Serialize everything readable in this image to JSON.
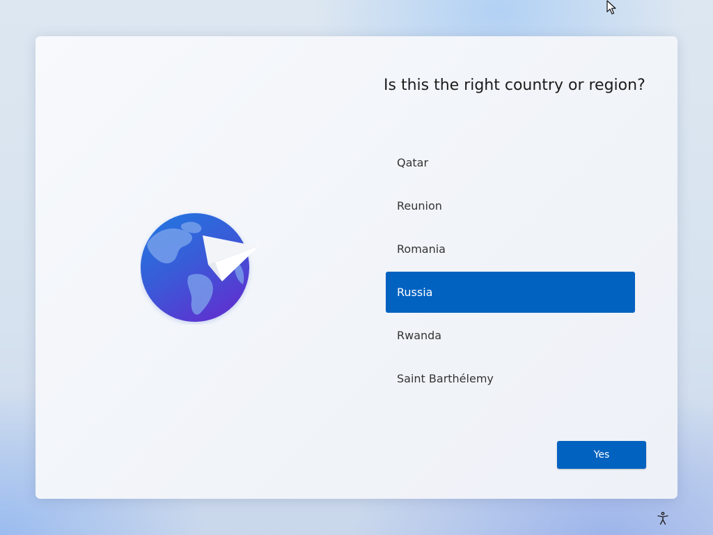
{
  "title": "Is this the right country or region?",
  "countries": {
    "items": [
      {
        "label": "Qatar"
      },
      {
        "label": "Reunion"
      },
      {
        "label": "Romania"
      },
      {
        "label": "Russia"
      },
      {
        "label": "Rwanda"
      },
      {
        "label": "Saint Barthélemy"
      }
    ],
    "selected": "Russia"
  },
  "actions": {
    "yes_label": "Yes"
  },
  "colors": {
    "accent": "#0262c0",
    "globe_ocean_top": "#1f7ae0",
    "globe_ocean_bottom": "#5b35d0",
    "card_background": "#f4f6fa"
  },
  "icons": {
    "illustration": "globe-with-paper-plane-icon",
    "accessibility": "accessibility-icon",
    "cursor": "mouse-pointer-icon"
  }
}
